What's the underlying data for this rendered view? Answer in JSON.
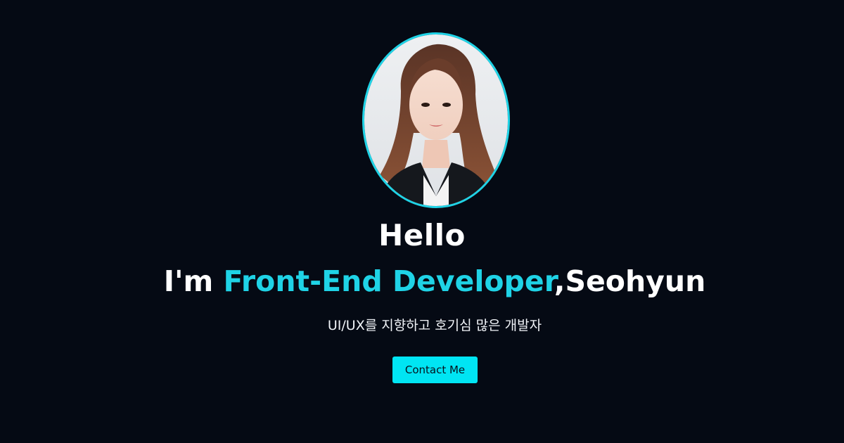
{
  "hero": {
    "greeting": "Hello",
    "intro_prefix": "I'm ",
    "intro_role": "Front-End Developer",
    "intro_suffix": ",Seohyun",
    "tagline": "UI/UX를 지향하고 호기심 많은 개발자",
    "contact_label": "Contact Me"
  },
  "colors": {
    "background": "#050a14",
    "accent": "#1fd3e6",
    "button": "#00e5f3",
    "text": "#ffffff"
  }
}
